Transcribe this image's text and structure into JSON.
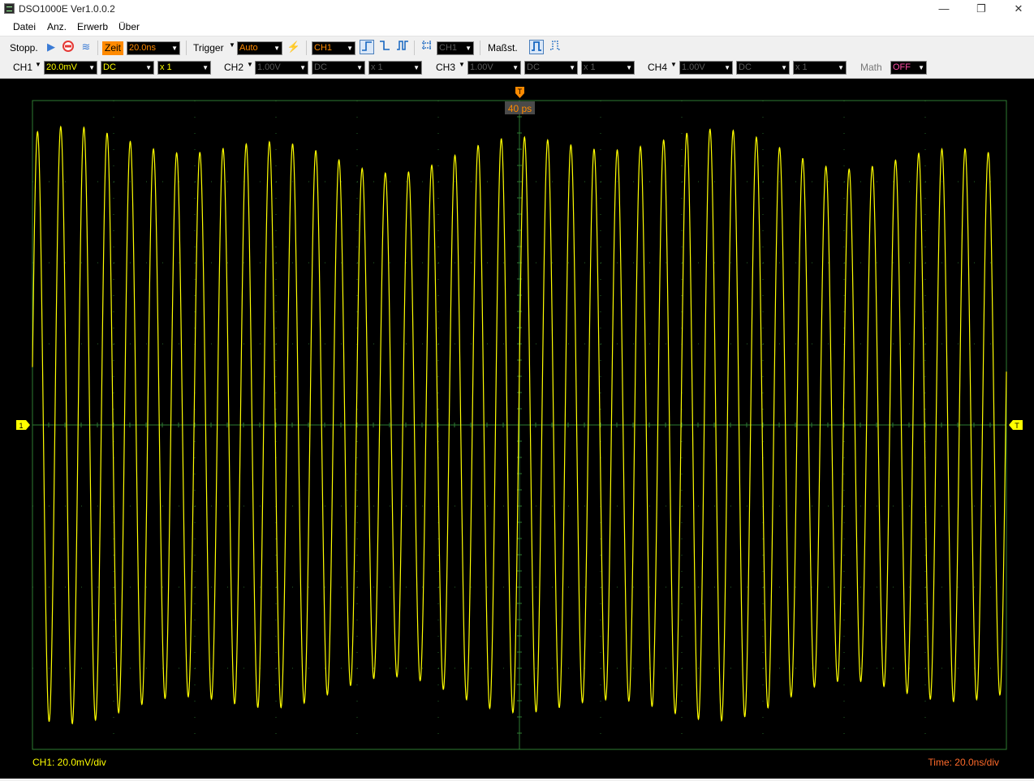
{
  "window": {
    "title": "DSO1000E Ver1.0.0.2",
    "minimize": "—",
    "restore": "❐",
    "close": "✕"
  },
  "menu": [
    "Datei",
    "Anz.",
    "Erwerb",
    "Über"
  ],
  "toolbar": {
    "run_state": "Stopp.",
    "zeit_label": "Zeit",
    "timebase": "20.0ns",
    "trigger_label": "Trigger",
    "trigger_mode": "Auto",
    "trigger_source": "CH1",
    "trigger_channel2": "CH1",
    "measure_label": "Maßst."
  },
  "channels": {
    "ch1": {
      "label": "CH1",
      "volts": "20.0mV",
      "coupling": "DC",
      "probe": "x 1"
    },
    "ch2": {
      "label": "CH2",
      "volts": "1.00V",
      "coupling": "DC",
      "probe": "x 1"
    },
    "ch3": {
      "label": "CH3",
      "volts": "1.00V",
      "coupling": "DC",
      "probe": "x 1"
    },
    "ch4": {
      "label": "CH4",
      "volts": "1.00V",
      "coupling": "DC",
      "probe": "x 1"
    },
    "math": {
      "label": "Math",
      "state": "OFF"
    }
  },
  "scope": {
    "trigger_offset": "40 ps",
    "trigger_marker": "T",
    "ch1_marker": "1",
    "level_marker": "T",
    "ch1_readout": "CH1: 20.0mV/div",
    "time_readout": "Time: 20.0ns/div",
    "colors": {
      "trace": "#ffff00",
      "grid": "#2e7d32",
      "trigger": "#ff8a00",
      "background": "#000000"
    },
    "divisions": {
      "horizontal": 12,
      "vertical": 8
    },
    "trace": {
      "cycles": 42,
      "amplitude_div": 3.4,
      "amplitude_variation_div": 0.3
    }
  }
}
